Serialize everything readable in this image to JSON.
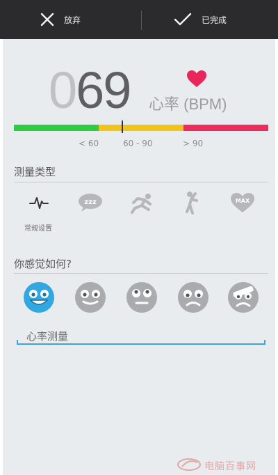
{
  "topbar": {
    "cancel_label": "放弃",
    "done_label": "已完成"
  },
  "reading": {
    "bpm_lead": "0",
    "bpm_digits": "69",
    "unit_label": "心率 (BPM)",
    "gauge_ranges": [
      "< 60",
      "60 - 90",
      "> 90"
    ],
    "gauge_colors": [
      "#2ecc40",
      "#f0c419",
      "#ee2a5f"
    ],
    "marker_value": 69
  },
  "measurement_type": {
    "title": "测量类型",
    "options": [
      {
        "icon": "pulse-icon",
        "label": "常规设置",
        "selected": true
      },
      {
        "icon": "zzz-speech-icon",
        "label": "",
        "selected": false
      },
      {
        "icon": "runner-start-icon",
        "label": "",
        "selected": false
      },
      {
        "icon": "stretching-icon",
        "label": "",
        "selected": false
      },
      {
        "icon": "heart-max-icon",
        "label": "MAX",
        "selected": false
      }
    ]
  },
  "mood": {
    "title": "你感觉如何?",
    "selected_color": "#33a8e0",
    "faces": [
      "happy-face-icon",
      "neutral-face-icon",
      "surprised-face-icon",
      "sad-face-icon",
      "sick-face-icon"
    ]
  },
  "note": {
    "value": "心率测量"
  },
  "watermark": {
    "text": "电脑百事网"
  }
}
